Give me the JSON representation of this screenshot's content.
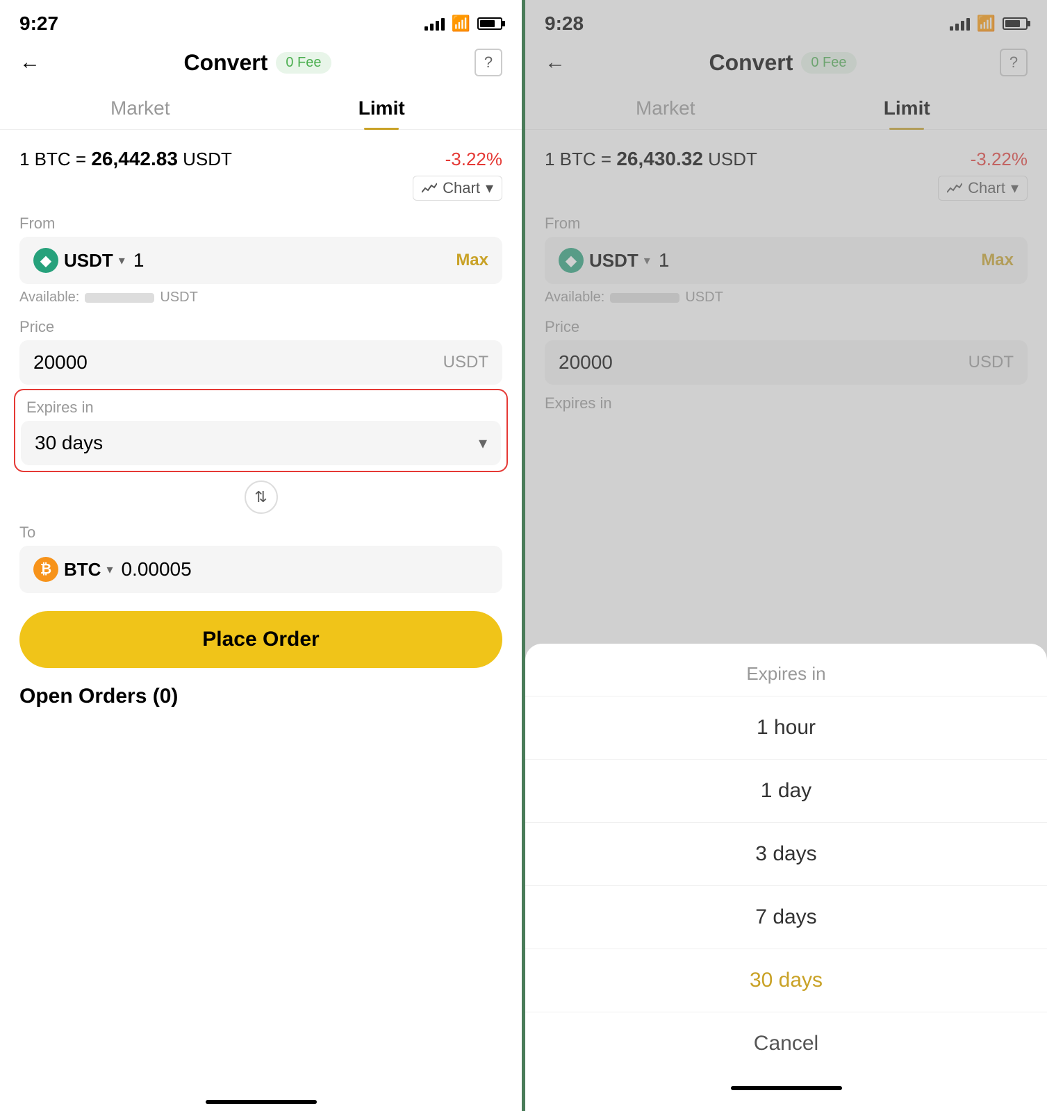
{
  "left_screen": {
    "status_time": "9:27",
    "header": {
      "title": "Convert",
      "fee_badge": "0 Fee",
      "back_label": "←",
      "help_label": "?"
    },
    "tabs": [
      {
        "label": "Market",
        "active": false
      },
      {
        "label": "Limit",
        "active": true
      }
    ],
    "rate": {
      "text_prefix": "1 BTC =",
      "rate_value": "26,442.83",
      "rate_suffix": "USDT",
      "change": "-3.22%"
    },
    "chart_label": "Chart",
    "from_label": "From",
    "from_currency": "USDT",
    "from_amount": "1",
    "from_max": "Max",
    "available_label": "Available:",
    "available_suffix": "USDT",
    "price_label": "Price",
    "price_value": "20000",
    "price_suffix": "USDT",
    "expires_label": "Expires in",
    "expires_value": "30 days",
    "to_label": "To",
    "to_currency": "BTC",
    "to_amount": "0.00005",
    "place_order_label": "Place Order",
    "open_orders_label": "Open Orders (0)"
  },
  "right_screen": {
    "status_time": "9:28",
    "header": {
      "title": "Convert",
      "fee_badge": "0 Fee",
      "back_label": "←",
      "help_label": "?"
    },
    "tabs": [
      {
        "label": "Market",
        "active": false
      },
      {
        "label": "Limit",
        "active": true
      }
    ],
    "rate": {
      "text_prefix": "1 BTC =",
      "rate_value": "26,430.32",
      "rate_suffix": "USDT",
      "change": "-3.22%"
    },
    "chart_label": "Chart",
    "from_label": "From",
    "from_currency": "USDT",
    "from_amount": "1",
    "from_max": "Max",
    "available_label": "Available:",
    "available_suffix": "USDT",
    "price_label": "Price",
    "price_value": "20000",
    "price_suffix": "USDT",
    "expires_label": "Expires in",
    "sheet": {
      "header_label": "Expires in",
      "items": [
        {
          "label": "1 hour",
          "selected": false
        },
        {
          "label": "1 day",
          "selected": false
        },
        {
          "label": "3 days",
          "selected": false
        },
        {
          "label": "7 days",
          "selected": false
        },
        {
          "label": "30 days",
          "selected": true
        },
        {
          "label": "Cancel",
          "is_cancel": true
        }
      ]
    }
  },
  "colors": {
    "accent_yellow": "#f0c419",
    "accent_gold": "#c9a227",
    "red": "#e53935",
    "green": "#4caf50",
    "tether_green": "#26a17b",
    "btc_orange": "#f7931a"
  }
}
